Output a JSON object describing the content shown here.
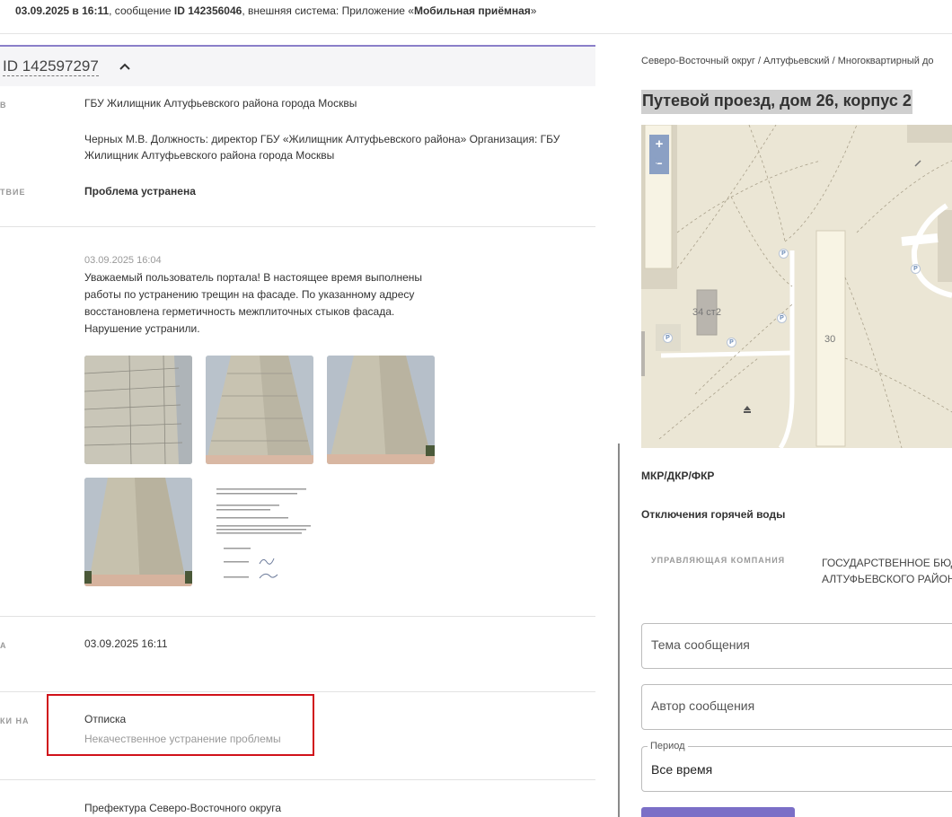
{
  "topbar": {
    "datetime": "03.09.2025 в 16:11",
    "message_prefix": ", сообщение ",
    "message_id": "ID 142356046",
    "system_prefix": ", внешняя система: Приложение «",
    "system_name": "Мобильная приёмная",
    "system_suffix": "»"
  },
  "record": {
    "id_label": "ID 142597297",
    "executor_label": "В",
    "executor": "ГБУ Жилищник Алтуфьевского района города Москвы",
    "responsible": "Черных М.В. Должность: директор ГБУ «Жилищник Алтуфьевского района» Организация: ГБУ Жилищник Алтуфьевского района города Москвы",
    "result_label": "ТВИЕ",
    "result": "Проблема устранена",
    "reply_date": "03.09.2025 16:04",
    "reply_text": "Уважаемый пользователь портала! В настоящее время выполнены работы по устранению трещин на фасаде. По указанному адресу восстановлена герметичность межплиточных стыков фасада. Нарушение устранили.",
    "date_label": "А",
    "date_value": "03.09.2025 16:11",
    "complaint_label": "КИ НА",
    "complaint_type": "Отписка",
    "complaint_reason": "Некачественное устранение проблемы",
    "prefecture": "Префектура Северо-Восточного округа"
  },
  "right": {
    "breadcrumb": "Северо-Восточный округ / Алтуфьевский / Многоквартирный до",
    "address": "Путевой проезд, дом 26, корпус 2",
    "map": {
      "zoom_in": "+",
      "zoom_out": "−",
      "building_34": "34",
      "building_34_2": "34 ст2",
      "building_30": "30",
      "parking": "P"
    },
    "section_mkr": "МКР/ДКР/ФКР",
    "section_hot_water": "Отключения горячей воды",
    "mgmt_label": "УПРАВЛЯЮЩАЯ КОМПАНИЯ",
    "mgmt_line1": "ГОСУДАРСТВЕННОЕ БЮД",
    "mgmt_line2": "АЛТУФЬЕВСКОГО РАЙОН",
    "topic_placeholder": "Тема сообщения",
    "author_placeholder": "Автор сообщения",
    "period_legend": "Период",
    "period_value": "Все время"
  },
  "colors": {
    "accent": "#7b6fc7",
    "highlight_border": "#d0121a"
  }
}
